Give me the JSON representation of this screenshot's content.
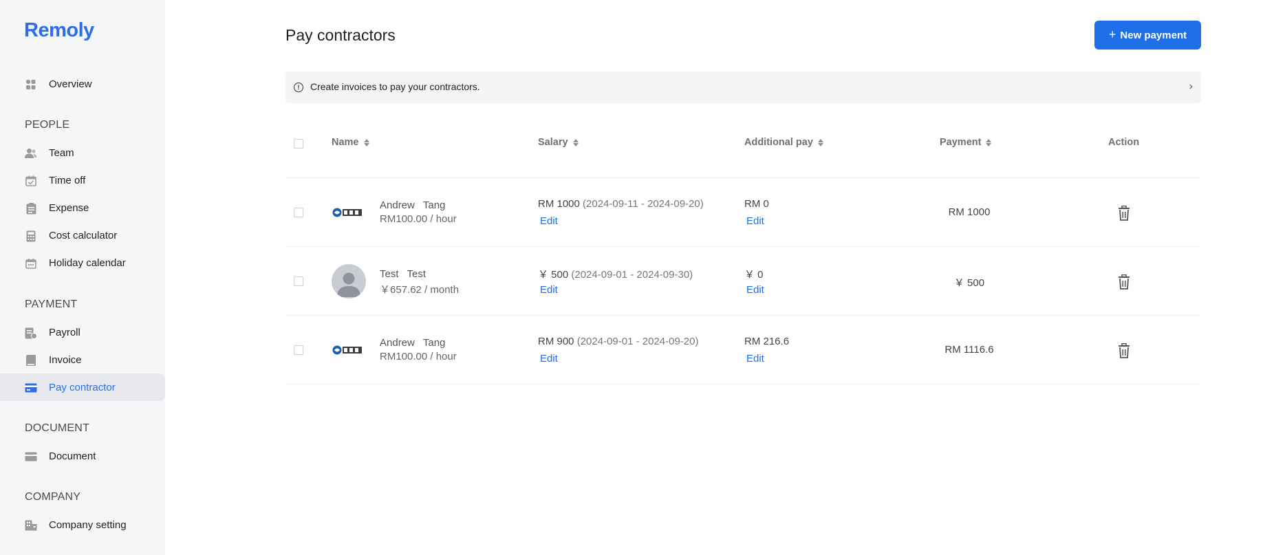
{
  "app": {
    "logo": "Remoly"
  },
  "sidebar": {
    "overview": "Overview",
    "sections": {
      "people": "PEOPLE",
      "payment": "PAYMENT",
      "document": "DOCUMENT",
      "company": "COMPANY"
    },
    "items": {
      "team": "Team",
      "time_off": "Time off",
      "expense": "Expense",
      "cost_calculator": "Cost calculator",
      "holiday_calendar": "Holiday calendar",
      "payroll": "Payroll",
      "invoice": "Invoice",
      "pay_contractor": "Pay contractor",
      "document": "Document",
      "company_setting": "Company setting"
    },
    "active_item": "Pay contractor",
    "icon_color": "#9a9a9a",
    "active_color": "#2d6ee8"
  },
  "header": {
    "title": "Pay contractors",
    "new_payment_label": "New payment"
  },
  "info_bar": {
    "text": "Create invoices to pay your contractors."
  },
  "table": {
    "columns": {
      "name": "Name",
      "salary": "Salary",
      "additional_pay": "Additional pay",
      "payment": "Payment",
      "action": "Action"
    },
    "rows": [
      {
        "first_name": "Andrew",
        "last_name": "Tang",
        "rate": "RM100.00 / hour",
        "salary_amount": "RM 1000",
        "salary_range": "(2024-09-11 - 2024-09-20)",
        "additional": "RM 0",
        "payment": "RM 1000",
        "edit_label": "Edit",
        "avatar": "company-logo"
      },
      {
        "first_name": "Test",
        "last_name": "Test",
        "rate": "￥657.62 / month",
        "salary_amount": "￥ 500",
        "salary_range": "(2024-09-01 - 2024-09-30)",
        "additional": "￥ 0",
        "payment": "￥ 500",
        "edit_label": "Edit",
        "avatar": "default-person"
      },
      {
        "first_name": "Andrew",
        "last_name": "Tang",
        "rate": "RM100.00 / hour",
        "salary_amount": "RM 900",
        "salary_range": "(2024-09-01 - 2024-09-20)",
        "additional": "RM 216.6",
        "payment": "RM 1116.6",
        "edit_label": "Edit",
        "avatar": "company-logo"
      }
    ]
  },
  "colors": {
    "primary": "#1d6fe8",
    "sidebar_bg": "#f5f6f7"
  }
}
